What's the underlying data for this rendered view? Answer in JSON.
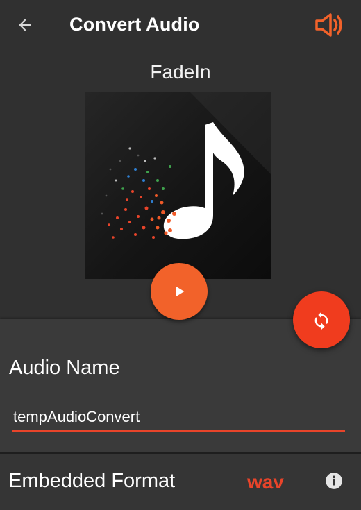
{
  "header": {
    "title": "Convert Audio",
    "back_icon": "arrow-left-icon",
    "volume_icon": "volume-icon"
  },
  "track": {
    "title": "FadeIn",
    "artwork_icon": "music-note-icon"
  },
  "controls": {
    "play_icon": "play-icon",
    "convert_icon": "sync-icon"
  },
  "form": {
    "audio_name_label": "Audio Name",
    "audio_name_value": "tempAudioConvert",
    "embedded_format_label": "Embedded Format",
    "embedded_format_value": "wav",
    "info_icon": "info-icon"
  },
  "colors": {
    "accent": "#f2622a",
    "accent_red": "#e8442a",
    "background": "#303030",
    "panel": "#3a3a3a"
  }
}
